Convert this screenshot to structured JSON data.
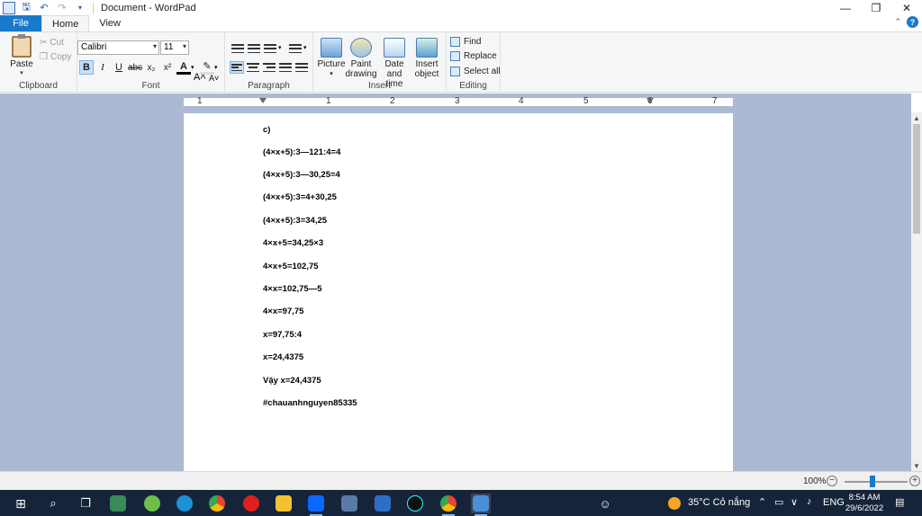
{
  "window": {
    "title": "Document - WordPad"
  },
  "tabs": [
    {
      "label": "File"
    },
    {
      "label": "Home"
    },
    {
      "label": "View"
    }
  ],
  "ribbon": {
    "clipboard": {
      "paste": "Paste",
      "cut": "Cut",
      "copy": "Copy",
      "label": "Clipboard"
    },
    "font": {
      "family": "Calibri",
      "size": "11",
      "label": "Font"
    },
    "paragraph": {
      "label": "Paragraph"
    },
    "insert": {
      "picture": "Picture",
      "paint1": "Paint",
      "paint2": "drawing",
      "date1": "Date and",
      "date2": "time",
      "obj1": "Insert",
      "obj2": "object",
      "label": "Insert"
    },
    "editing": {
      "find": "Find",
      "replace": "Replace",
      "select_all": "Select all",
      "label": "Editing"
    }
  },
  "ruler": {
    "numbers": [
      "1",
      "1",
      "2",
      "3",
      "4",
      "5",
      "6",
      "7"
    ]
  },
  "document": {
    "lines": [
      "c)",
      "(4×x+5):3—121:4=4",
      "(4×x+5):3—30,25=4",
      "(4×x+5):3=4+30,25",
      "(4×x+5):3=34,25",
      "4×x+5=34,25×3",
      "4×x+5=102,75",
      "4×x=102,75—5",
      "4×x=97,75",
      "x=97,75:4",
      "x=24,4375",
      "Vậy x=24,4375",
      "#chauanhnguyen85335"
    ]
  },
  "status": {
    "zoom": "100%"
  },
  "taskbar": {
    "weather": "35°C Cỏ nắng",
    "lang": "ENG",
    "time": "8:54 AM",
    "date": "29/6/2022"
  },
  "colors": {
    "accent": "#1979ca",
    "taskbar": "#16243a",
    "doc_bg": "#abb9d3"
  }
}
